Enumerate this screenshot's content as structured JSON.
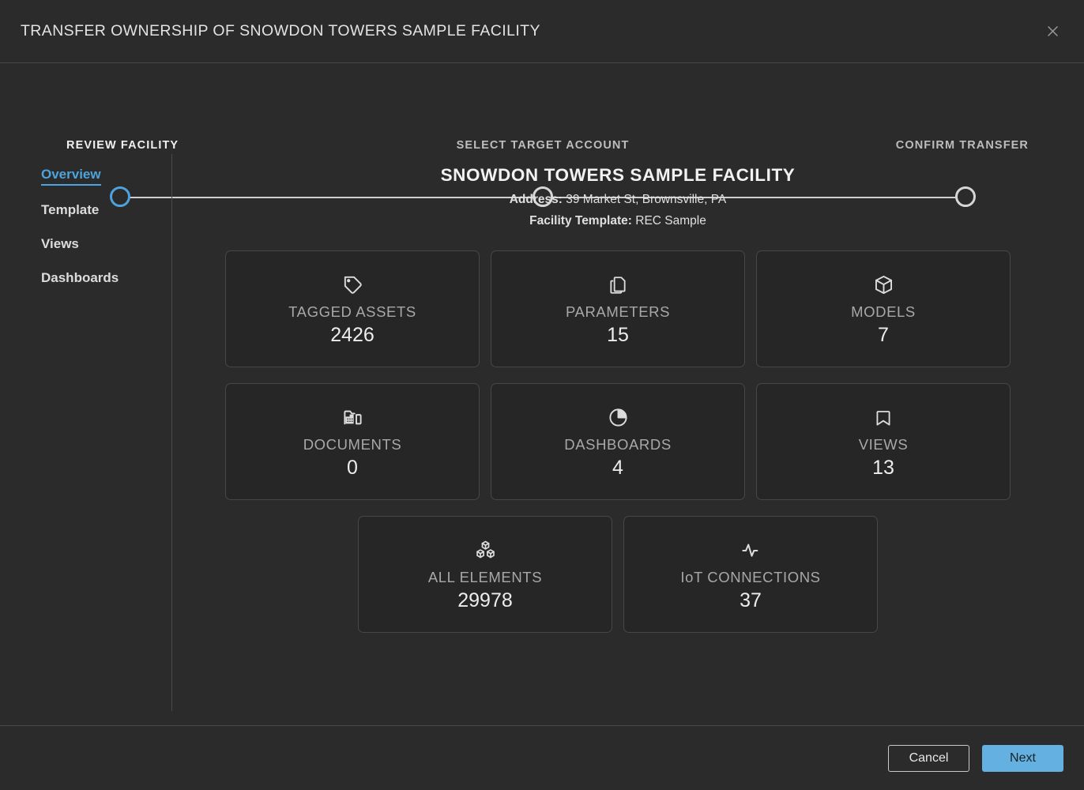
{
  "dialog": {
    "title": "TRANSFER OWNERSHIP OF SNOWDON TOWERS SAMPLE FACILITY",
    "close_icon": "close-icon"
  },
  "stepper": {
    "active_index": 0,
    "steps": [
      {
        "label": "REVIEW FACILITY",
        "state": "active"
      },
      {
        "label": "SELECT TARGET ACCOUNT",
        "state": "inactive"
      },
      {
        "label": "CONFIRM TRANSFER",
        "state": "inactive"
      }
    ],
    "active_color": "#4da3dd",
    "inactive_color": "#d6d6d6"
  },
  "sidebar": {
    "items": [
      {
        "label": "Overview",
        "active": true
      },
      {
        "label": "Template",
        "active": false
      },
      {
        "label": "Views",
        "active": false
      },
      {
        "label": "Dashboards",
        "active": false
      }
    ]
  },
  "facility": {
    "name": "SNOWDON TOWERS SAMPLE FACILITY",
    "address_label": "Address:",
    "address_value": "39 Market St, Brownsville, PA",
    "template_label": "Facility Template:",
    "template_value": "REC Sample"
  },
  "stats": {
    "rows": [
      [
        {
          "icon": "tag-icon",
          "label": "TAGGED ASSETS",
          "value": "2426"
        },
        {
          "icon": "copy-icon",
          "label": "PARAMETERS",
          "value": "15"
        },
        {
          "icon": "cube-icon",
          "label": "MODELS",
          "value": "7"
        }
      ],
      [
        {
          "icon": "folder-building-icon",
          "label": "DOCUMENTS",
          "value": "0"
        },
        {
          "icon": "pie-chart-icon",
          "label": "DASHBOARDS",
          "value": "4"
        },
        {
          "icon": "bookmark-icon",
          "label": "VIEWS",
          "value": "13"
        }
      ],
      [
        {
          "icon": "boxes-icon",
          "label": "ALL ELEMENTS",
          "value": "29978"
        },
        {
          "icon": "activity-icon",
          "label": "IoT CONNECTIONS",
          "value": "37"
        }
      ]
    ]
  },
  "footer": {
    "cancel_label": "Cancel",
    "next_label": "Next",
    "primary_color": "#64b0e0"
  }
}
